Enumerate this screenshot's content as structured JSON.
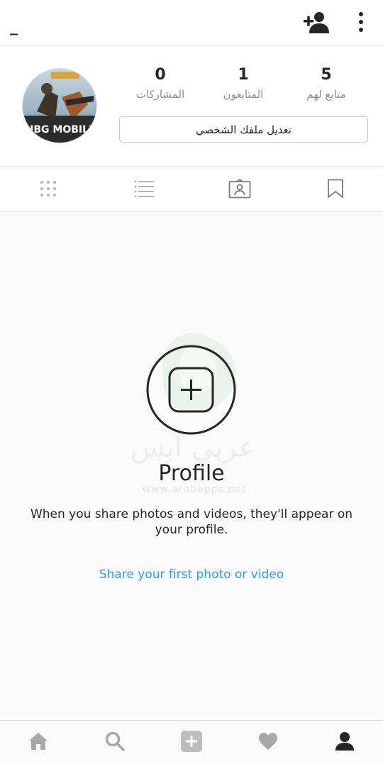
{
  "topbar": {
    "username": "_",
    "add_friend_icon": "add-person-icon",
    "more_icon": "vertical-dots-icon"
  },
  "profile": {
    "avatar_text": "UBG MOBILE LI",
    "stats": [
      {
        "key": "posts",
        "value": "0",
        "label": "المشاركات"
      },
      {
        "key": "followers",
        "value": "1",
        "label": "المتابعون"
      },
      {
        "key": "following",
        "value": "5",
        "label": "متابع لهم"
      }
    ],
    "edit_button": "تعديل ملفك الشخصي"
  },
  "tabs": [
    {
      "icon": "grid-icon"
    },
    {
      "icon": "list-icon"
    },
    {
      "icon": "tagged-photo-icon"
    },
    {
      "icon": "bookmark-icon"
    }
  ],
  "empty_state": {
    "title": "Profile",
    "message": "When you share photos and videos, they'll appear on your profile.",
    "link": "Share your first photo or video",
    "watermark_text": "عربي ابس",
    "watermark_url": "www.arabapps.net"
  },
  "bottom_nav": [
    {
      "icon": "home-icon"
    },
    {
      "icon": "search-icon"
    },
    {
      "icon": "add-post-icon"
    },
    {
      "icon": "heart-icon"
    },
    {
      "icon": "profile-icon"
    }
  ],
  "colors": {
    "link": "#3897f0",
    "border": "#dbdbdb",
    "muted": "#8e8e8e",
    "text": "#262626"
  }
}
